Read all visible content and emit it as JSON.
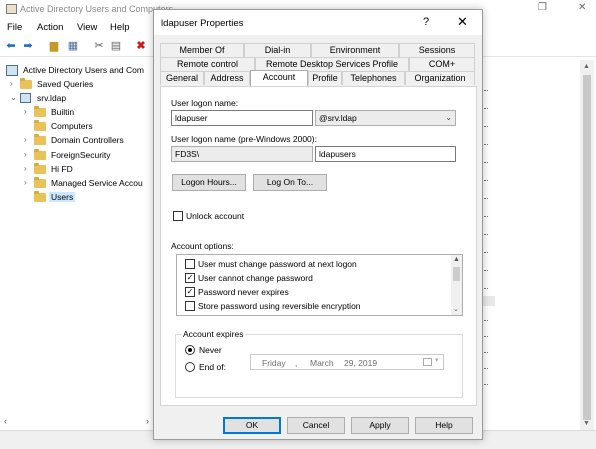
{
  "mmc": {
    "title": "Active Directory Users and Computers",
    "menu": [
      "File",
      "Action",
      "View",
      "Help"
    ],
    "tree": {
      "root": "Active Directory Users and Com",
      "saved_queries": "Saved Queries",
      "domain": "srv.ldap",
      "children": [
        "Builtin",
        "Computers",
        "Domain Controllers",
        "ForeignSecurity",
        "Hi FD",
        "Managed Service Accou",
        "Users"
      ],
      "selected": "Users"
    }
  },
  "dialog": {
    "title": "ldapuser  Properties",
    "help_glyph": "?",
    "close_glyph": "✕",
    "tabs_row1": [
      "Member Of",
      "Dial-in",
      "Environment",
      "Sessions"
    ],
    "tabs_row2": [
      "Remote control",
      "Remote Desktop Services Profile",
      "COM+"
    ],
    "tabs_row3": [
      "General",
      "Address",
      "Account",
      "Profile",
      "Telephones",
      "Organization"
    ],
    "active_tab": "Account",
    "logon_name_label": "User logon name:",
    "logon_name_value": "ldapuser",
    "logon_domain_value": "@srv.ldap",
    "pre2000_label": "User logon name (pre-Windows 2000):",
    "pre2000_domain": "FD3S\\",
    "pre2000_user": "ldapusers",
    "logon_hours_button": "Logon Hours...",
    "logon_to_button": "Log On To...",
    "unlock_label": "Unlock account",
    "account_options_label": "Account options:",
    "account_options": [
      {
        "label": "User must change password at next logon",
        "checked": false
      },
      {
        "label": "User cannot change password",
        "checked": true
      },
      {
        "label": "Password never expires",
        "checked": true
      },
      {
        "label": "Store password using reversible encryption",
        "checked": false
      }
    ],
    "account_expires_label": "Account expires",
    "never_label": "Never",
    "end_of_label": "End of:",
    "expiry_date": {
      "day": "Friday",
      "month": "March",
      "date": "29, 2019",
      "sep": ","
    },
    "buttons": {
      "ok": "OK",
      "cancel": "Cancel",
      "apply": "Apply",
      "help": "Help"
    }
  }
}
